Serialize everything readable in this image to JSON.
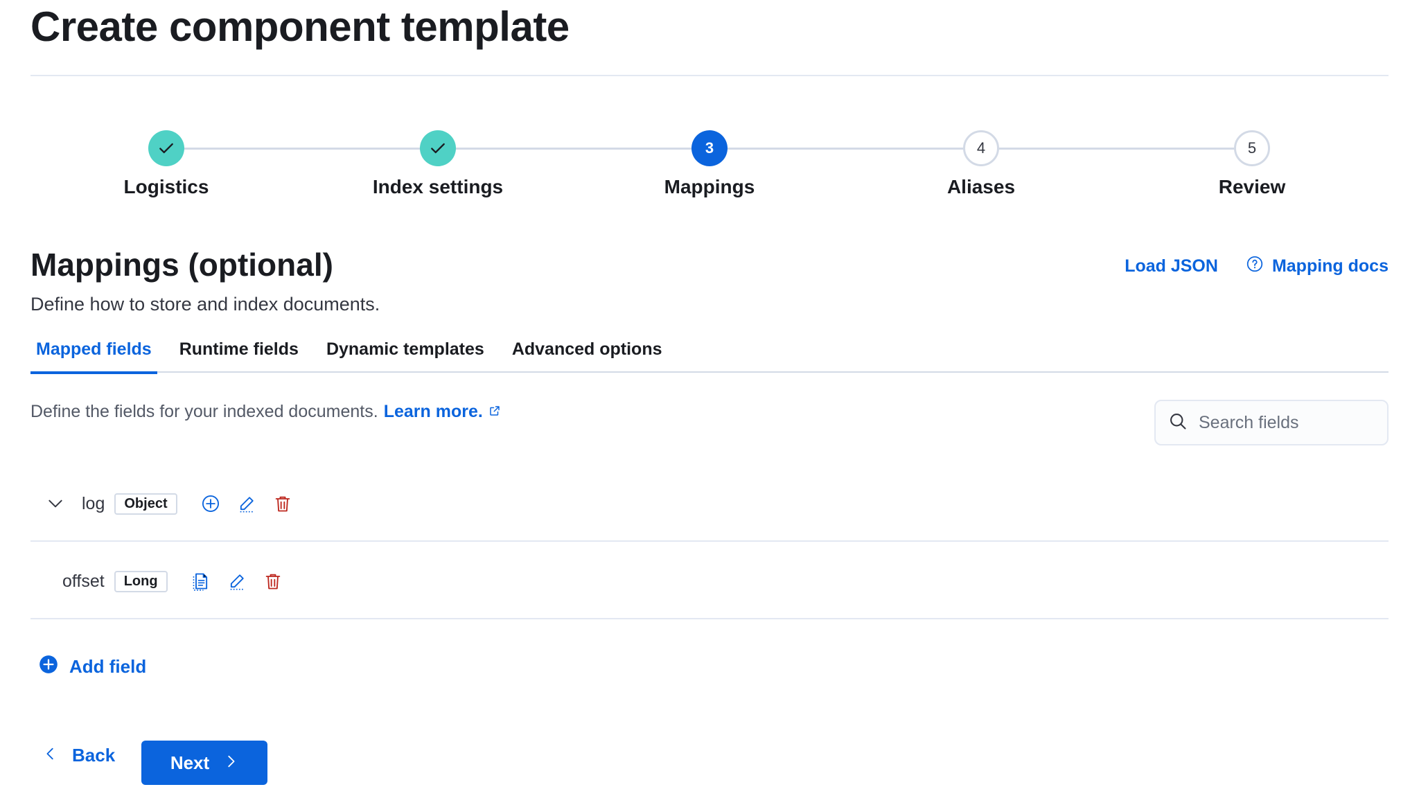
{
  "page": {
    "title": "Create component template"
  },
  "stepper": {
    "steps": [
      {
        "label": "Logistics",
        "status": "complete",
        "number": "1"
      },
      {
        "label": "Index settings",
        "status": "complete",
        "number": "2"
      },
      {
        "label": "Mappings",
        "status": "current",
        "number": "3"
      },
      {
        "label": "Aliases",
        "status": "incomplete",
        "number": "4"
      },
      {
        "label": "Review",
        "status": "incomplete",
        "number": "5"
      }
    ]
  },
  "section": {
    "title": "Mappings (optional)",
    "description": "Define how to store and index documents.",
    "load_json": "Load JSON",
    "mapping_docs": "Mapping docs"
  },
  "tabs": [
    {
      "label": "Mapped fields",
      "active": true
    },
    {
      "label": "Runtime fields",
      "active": false
    },
    {
      "label": "Dynamic templates",
      "active": false
    },
    {
      "label": "Advanced options",
      "active": false
    }
  ],
  "fields_panel": {
    "description": "Define the fields for your indexed documents.",
    "learn_more": "Learn more.",
    "search_placeholder": "Search fields"
  },
  "fields": [
    {
      "name": "log",
      "type": "Object",
      "expandable": true,
      "actions": [
        "add",
        "edit",
        "delete"
      ]
    },
    {
      "name": "offset",
      "type": "Long",
      "expandable": false,
      "actions": [
        "multi-field",
        "edit",
        "delete"
      ]
    }
  ],
  "add_field": "Add field",
  "footer": {
    "back": "Back",
    "next": "Next"
  },
  "colors": {
    "primary": "#0b64dd",
    "success": "#4fd1c5",
    "danger": "#bd271e",
    "border": "#d3dae6"
  }
}
